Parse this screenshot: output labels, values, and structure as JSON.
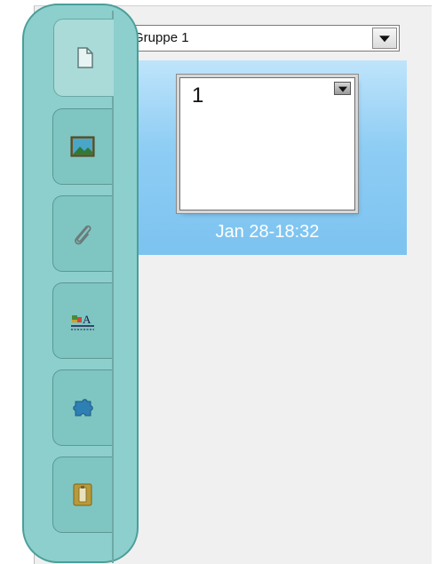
{
  "tabs": [
    {
      "icon": "page-sorter-icon",
      "active": true
    },
    {
      "icon": "gallery-image-icon",
      "active": false
    },
    {
      "icon": "attachment-paperclip-icon",
      "active": false
    },
    {
      "icon": "properties-icon",
      "active": false
    },
    {
      "icon": "addons-puzzle-icon",
      "active": false
    },
    {
      "icon": "battery-icon",
      "active": false
    }
  ],
  "page_sorter": {
    "group_label": "Gruppe 1",
    "pages": [
      {
        "number": "1",
        "timestamp": "Jan 28-18:32",
        "selected": true
      }
    ]
  },
  "colors": {
    "tab_highlight": "#8ccfcc",
    "tab_highlight_border": "#4a9e9a",
    "selection": "#8ecdf4",
    "panel_background": "#f0f0f0"
  }
}
